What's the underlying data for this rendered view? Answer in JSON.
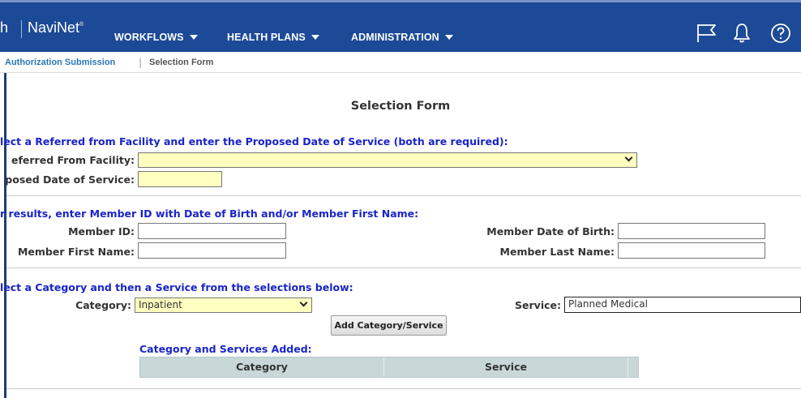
{
  "header": {
    "brand_stub": "h",
    "brand": "NaviNet",
    "brand_mark": "®",
    "nav": [
      {
        "label": "WORKFLOWS"
      },
      {
        "label": "HEALTH PLANS"
      },
      {
        "label": "ADMINISTRATION"
      }
    ],
    "icons": [
      "flag-icon",
      "bell-icon",
      "help-icon"
    ]
  },
  "breadcrumb": {
    "link": "Authorization Submission",
    "separator": "|",
    "current": "Selection Form"
  },
  "form": {
    "title": "Selection Form",
    "section1": {
      "heading": "lect a Referred from Facility and enter the Proposed Date of Service (both are required):",
      "facility_label": "eferred From Facility:",
      "facility_value": "",
      "date_label": "posed Date of Service:",
      "date_value": ""
    },
    "section2": {
      "heading": "r results, enter Member ID with Date of Birth and/or Member First Name:",
      "member_id_label": "Member ID:",
      "member_id_value": "",
      "dob_label": "Member Date of Birth:",
      "dob_value": "",
      "first_name_label": "Member First Name:",
      "first_name_value": "",
      "last_name_label": "Member Last Name:",
      "last_name_value": ""
    },
    "section3": {
      "heading": "lect a Category and then a Service from the selections below:",
      "category_label": "Category:",
      "category_value": "Inpatient",
      "service_label": "Service:",
      "service_value": "Planned Medical",
      "add_button": "Add Category/Service",
      "added_heading": "Category and Services Added:",
      "table_headers": [
        "Category",
        "Service"
      ]
    }
  },
  "colors": {
    "nav_bg": "#1c4a97",
    "heading_blue": "#1a24c8",
    "required_yellow": "#ffffc0",
    "table_header": "#c8d8d8"
  }
}
